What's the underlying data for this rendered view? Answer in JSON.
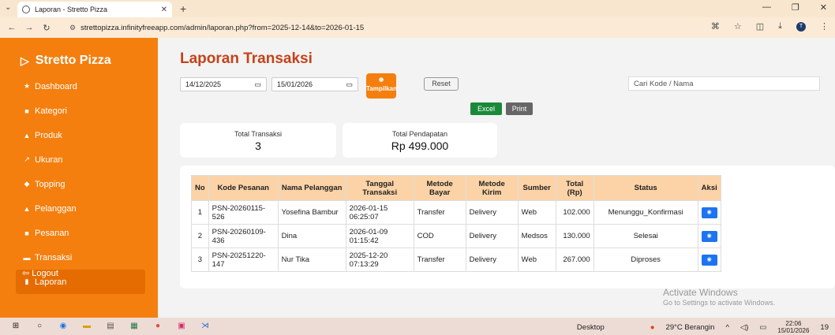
{
  "browser": {
    "tab_title": "Laporan - Stretto Pizza",
    "url": "strettopizza.infinityfreeapp.com/admin/laporan.php?from=2025-12-14&to=2026-01-15",
    "profile_initial": "T"
  },
  "sidebar": {
    "brand": "Stretto Pizza",
    "items": [
      {
        "icon": "home-icon",
        "glyph": "★",
        "label": "Dashboard"
      },
      {
        "icon": "tag-icon",
        "glyph": "■",
        "label": "Kategori"
      },
      {
        "icon": "pizza-icon",
        "glyph": "▲",
        "label": "Produk"
      },
      {
        "icon": "ruler-icon",
        "glyph": "↗",
        "label": "Ukuran"
      },
      {
        "icon": "topping-icon",
        "glyph": "◆",
        "label": "Topping"
      },
      {
        "icon": "users-icon",
        "glyph": "▲",
        "label": "Pelanggan"
      },
      {
        "icon": "cart-icon",
        "glyph": "■",
        "label": "Pesanan"
      },
      {
        "icon": "receipt-icon",
        "glyph": "▬",
        "label": "Transaksi"
      },
      {
        "icon": "chart-icon",
        "glyph": "▮",
        "label": "Laporan"
      }
    ],
    "logout": "Logout"
  },
  "main": {
    "title": "Laporan Transaksi",
    "date_from": "14/12/2025",
    "date_to": "15/01/2026",
    "show_button": "Tampilkan",
    "reset_button": "Reset",
    "search_placeholder": "Cari Kode / Nama",
    "excel_button": "Excel",
    "print_button": "Print",
    "summary": {
      "total_transaksi_label": "Total Transaksi",
      "total_transaksi_value": "3",
      "total_pendapatan_label": "Total Pendapatan",
      "total_pendapatan_value": "Rp 499.000"
    },
    "table": {
      "headers": [
        "No",
        "Kode Pesanan",
        "Nama Pelanggan",
        "Tanggal Transaksi",
        "Metode Bayar",
        "Metode Kirim",
        "Sumber",
        "Total (Rp)",
        "Status",
        "Aksi"
      ],
      "rows": [
        {
          "no": "1",
          "kode": "PSN-20260115-526",
          "nama": "Yosefina Bambur",
          "tanggal": "2026-01-15 06:25:07",
          "bayar": "Transfer",
          "kirim": "Delivery",
          "sumber": "Web",
          "total": "102.000",
          "status": "Menunggu_Konfirmasi"
        },
        {
          "no": "2",
          "kode": "PSN-20260109-436",
          "nama": "Dina",
          "tanggal": "2026-01-09 01:15:42",
          "bayar": "COD",
          "kirim": "Delivery",
          "sumber": "Medsos",
          "total": "130.000",
          "status": "Selesai"
        },
        {
          "no": "3",
          "kode": "PSN-20251220-147",
          "nama": "Nur Tika",
          "tanggal": "2025-12-20 07:13:29",
          "bayar": "Transfer",
          "kirim": "Delivery",
          "sumber": "Web",
          "total": "267.000",
          "status": "Diproses"
        }
      ]
    }
  },
  "watermark": {
    "line1": "Activate Windows",
    "line2": "Go to Settings to activate Windows."
  },
  "taskbar": {
    "desktop_label": "Desktop",
    "weather": "29°C Berangin",
    "time": "22:06",
    "date": "15/01/2026",
    "notification_count": "19"
  },
  "colors": {
    "brand_orange": "#f47f0e",
    "title_red": "#c4421a",
    "header_peach": "#fbd3a7",
    "excel_green": "#1a8a3a",
    "action_blue": "#1d74f0"
  }
}
